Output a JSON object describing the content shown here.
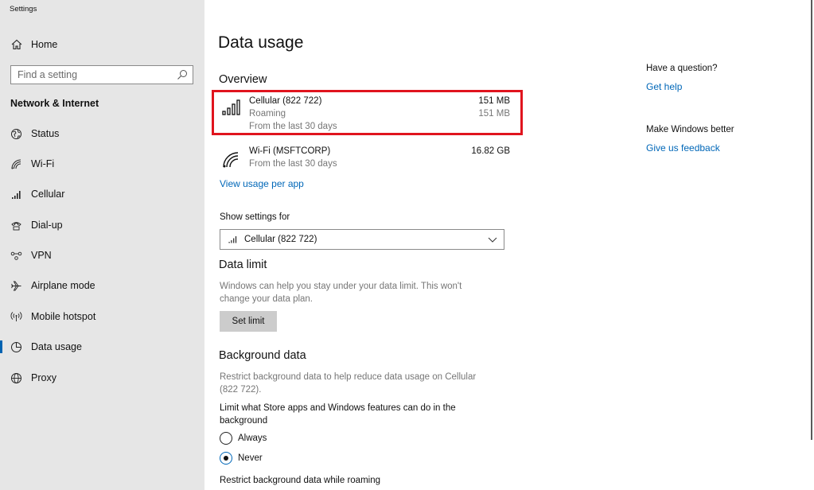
{
  "app": {
    "title": "Settings"
  },
  "sidebar": {
    "home_label": "Home",
    "search_placeholder": "Find a setting",
    "section_title": "Network & Internet",
    "items": [
      {
        "label": "Status",
        "icon": "globe-icon"
      },
      {
        "label": "Wi-Fi",
        "icon": "wifi-icon"
      },
      {
        "label": "Cellular",
        "icon": "cellular-icon"
      },
      {
        "label": "Dial-up",
        "icon": "dialup-icon"
      },
      {
        "label": "VPN",
        "icon": "vpn-icon"
      },
      {
        "label": "Airplane mode",
        "icon": "airplane-icon"
      },
      {
        "label": "Mobile hotspot",
        "icon": "hotspot-icon"
      },
      {
        "label": "Data usage",
        "icon": "data-usage-icon",
        "active": true
      },
      {
        "label": "Proxy",
        "icon": "globe-icon"
      }
    ]
  },
  "main": {
    "title": "Data usage",
    "overview": {
      "heading": "Overview",
      "cellular": {
        "name": "Cellular (822 722)",
        "status": "Roaming",
        "period": "From the last 30 days",
        "amount": "151 MB",
        "roaming_amount": "151 MB"
      },
      "wifi": {
        "name": "Wi-Fi (MSFTCORP)",
        "period": "From the last 30 days",
        "amount": "16.82 GB"
      },
      "view_usage_link": "View usage per app"
    },
    "show_settings": {
      "label": "Show settings for",
      "selected": "Cellular (822 722)"
    },
    "data_limit": {
      "heading": "Data limit",
      "description_line1": "Windows can help you stay under your data limit. This won't",
      "description_line2": "change your data plan.",
      "button": "Set limit"
    },
    "background_data": {
      "heading": "Background data",
      "description_line1": "Restrict background data to help reduce data usage on Cellular",
      "description_line2": "(822 722).",
      "limit_label_line1": "Limit what Store apps and Windows features can do in the",
      "limit_label_line2": "background",
      "options": [
        "Always",
        "Never"
      ],
      "selected": "Never",
      "roaming_label": "Restrict background data while roaming"
    }
  },
  "rail": {
    "question_heading": "Have a question?",
    "help_link": "Get help",
    "better_heading": "Make Windows better",
    "feedback_link": "Give us feedback"
  },
  "colors": {
    "accent": "#0067b8",
    "highlight": "#e0141e",
    "sidebar_bg": "#e6e6e6"
  }
}
